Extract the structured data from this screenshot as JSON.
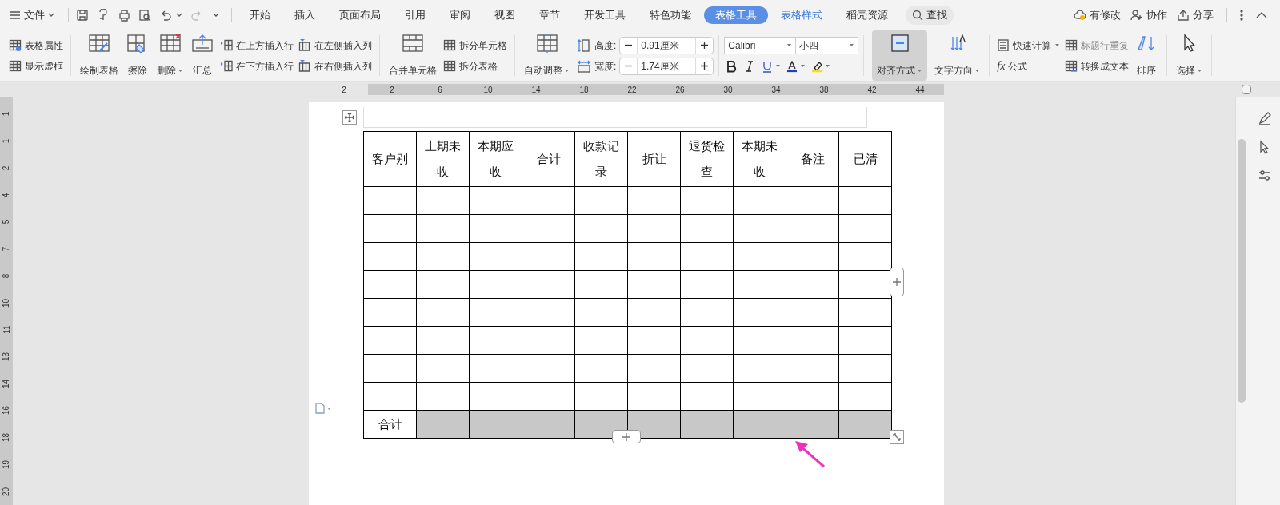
{
  "menu": {
    "file": "文件"
  },
  "tabs": [
    {
      "label": "开始",
      "selected": false,
      "kind": "normal"
    },
    {
      "label": "插入",
      "selected": false,
      "kind": "normal"
    },
    {
      "label": "页面布局",
      "selected": false,
      "kind": "normal"
    },
    {
      "label": "引用",
      "selected": false,
      "kind": "normal"
    },
    {
      "label": "审阅",
      "selected": false,
      "kind": "normal"
    },
    {
      "label": "视图",
      "selected": false,
      "kind": "normal"
    },
    {
      "label": "章节",
      "selected": false,
      "kind": "normal"
    },
    {
      "label": "开发工具",
      "selected": false,
      "kind": "normal"
    },
    {
      "label": "特色功能",
      "selected": false,
      "kind": "normal"
    },
    {
      "label": "表格工具",
      "selected": true,
      "kind": "context"
    },
    {
      "label": "表格样式",
      "selected": false,
      "kind": "context"
    },
    {
      "label": "稻壳资源",
      "selected": false,
      "kind": "normal"
    }
  ],
  "search": "查找",
  "right_actions": [
    "有修改",
    "协作",
    "分享"
  ],
  "ribbon": {
    "props": [
      "表格属性",
      "显示虚框"
    ],
    "draw": [
      "绘制表格",
      "擦除",
      "删除",
      "汇总"
    ],
    "insert": [
      "在上方插入行",
      "在下方插入行",
      "在左侧插入列",
      "在右侧插入列"
    ],
    "merge": "合并单元格",
    "split": [
      "拆分单元格",
      "拆分表格"
    ],
    "autofit": "自动调整",
    "height": {
      "label": "高度:",
      "value": "0.91厘米"
    },
    "width": {
      "label": "宽度:",
      "value": "1.74厘米"
    },
    "font": {
      "family": "Calibri",
      "size": "小四"
    },
    "align": {
      "label": "对齐方式",
      "selected": true
    },
    "direction": "文字方向",
    "calc": "快速计算",
    "repeat_header": {
      "label": "标题行重复",
      "disabled": true
    },
    "formula": {
      "icon": "fx",
      "label": "公式"
    },
    "to_text": "转换成文本",
    "sort": "排序",
    "select": "选择"
  },
  "ruler_h": [
    "2",
    "2",
    "6",
    "10",
    "14",
    "18",
    "22",
    "26",
    "30",
    "34",
    "38",
    "42",
    "44"
  ],
  "ruler_v": [
    "1",
    "1",
    "2",
    "4",
    "5",
    "7",
    "8",
    "10",
    "11",
    "13",
    "14",
    "16",
    "18",
    "19",
    "20"
  ],
  "table": {
    "columns": [
      "客户别",
      "上期未收",
      "本期应收",
      "合计",
      "收款记录",
      "折让",
      "退货检查",
      "本期未收",
      "备注",
      "已清"
    ],
    "rows": [
      {
        "kind": "blank"
      },
      {
        "kind": "blank"
      },
      {
        "kind": "blank"
      },
      {
        "kind": "blank"
      },
      {
        "kind": "blank"
      },
      {
        "kind": "blank"
      },
      {
        "kind": "blank"
      },
      {
        "kind": "blank"
      },
      {
        "kind": "total",
        "label": "合计",
        "selected": true
      }
    ]
  }
}
